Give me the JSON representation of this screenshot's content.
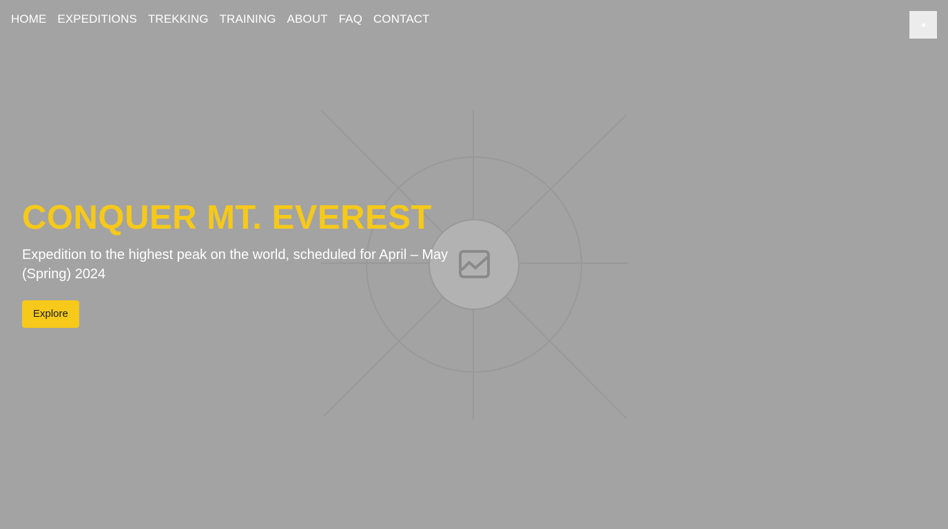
{
  "nav": {
    "items": [
      {
        "label": "HOME"
      },
      {
        "label": "EXPEDITIONS"
      },
      {
        "label": "TREKKING"
      },
      {
        "label": "TRAINING"
      },
      {
        "label": "ABOUT"
      },
      {
        "label": "FAQ"
      },
      {
        "label": "CONTACT"
      }
    ]
  },
  "menu_toggle": {
    "icon": "dot-icon"
  },
  "hero": {
    "title": "CONQUER MT. EVEREST",
    "subtitle": "Expedition to the highest peak on the world, scheduled for April – May (Spring) 2024",
    "button_label": "Explore",
    "background_icon": "image-placeholder-icon"
  },
  "colors": {
    "background": "#a3a3a3",
    "accent": "#f6c91a",
    "text": "#ffffff"
  }
}
